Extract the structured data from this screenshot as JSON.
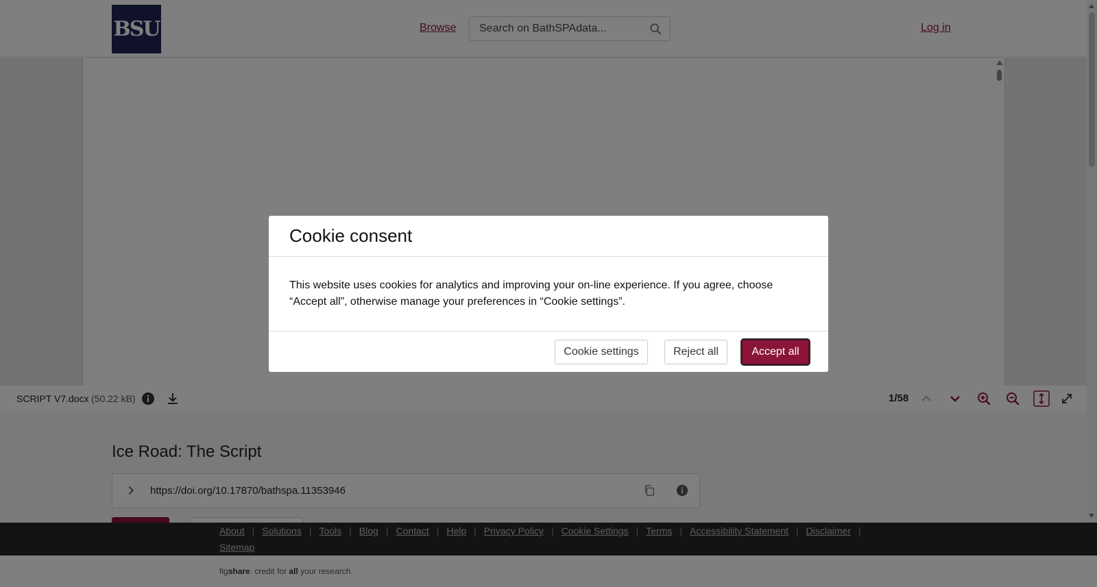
{
  "header": {
    "logo_text": "BSU",
    "browse_label": "Browse",
    "search_placeholder": "Search on BathSPAdata...",
    "login_label": "Log in"
  },
  "viewer": {
    "file_name": "SCRIPT V7.docx",
    "file_size": "(50.22 kB)",
    "page_indicator": "1/58"
  },
  "item": {
    "title": "Ice Road: The Script",
    "doi": "https://doi.org/10.17870/bathspa.11353946"
  },
  "footer": {
    "links": [
      "About",
      "Solutions",
      "Tools",
      "Blog",
      "Contact",
      "Help",
      "Privacy Policy",
      "Cookie Settings",
      "Terms",
      "Accessibility Statement",
      "Disclaimer",
      "Sitemap"
    ],
    "credit_fig": "fig",
    "credit_share": "share",
    "credit_mid": ". credit for ",
    "credit_all": "all",
    "credit_end": " your research."
  },
  "cookie_modal": {
    "title": "Cookie consent",
    "body": "This website uses cookies for analytics and improving your on-line experience. If you agree, choose “Accept all”, otherwise manage your preferences in “Cookie settings”.",
    "settings_label": "Cookie settings",
    "reject_label": "Reject all",
    "accept_label": "Accept all"
  },
  "colors": {
    "brand": "#8a1538",
    "logo_bg": "#1f2455",
    "footer_bg": "#262626"
  }
}
